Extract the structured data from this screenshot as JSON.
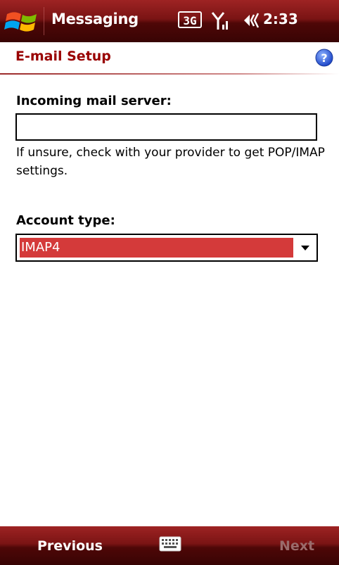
{
  "titlebar": {
    "app_title": "Messaging",
    "network_label": "3G",
    "time": "2:33"
  },
  "header": {
    "title": "E-mail Setup"
  },
  "form": {
    "server_label": "Incoming mail server:",
    "server_value": "",
    "hint_text": "If unsure, check with your provider to get POP/IMAP settings.",
    "account_type_label": "Account type:",
    "account_type_value": "IMAP4"
  },
  "softkeys": {
    "left_label": "Previous",
    "right_label": "Next"
  },
  "colors": {
    "titlebar": "#7a1414",
    "accent_text": "#990000",
    "selection": "#d43a3a",
    "disabled_softkey": "#9a6b6b"
  },
  "icons": {
    "start": "windows-flag-icon",
    "signal": "signal-strength-icon",
    "volume": "speaker-volume-icon",
    "help": "help-question-icon",
    "keyboard": "keyboard-icon"
  }
}
